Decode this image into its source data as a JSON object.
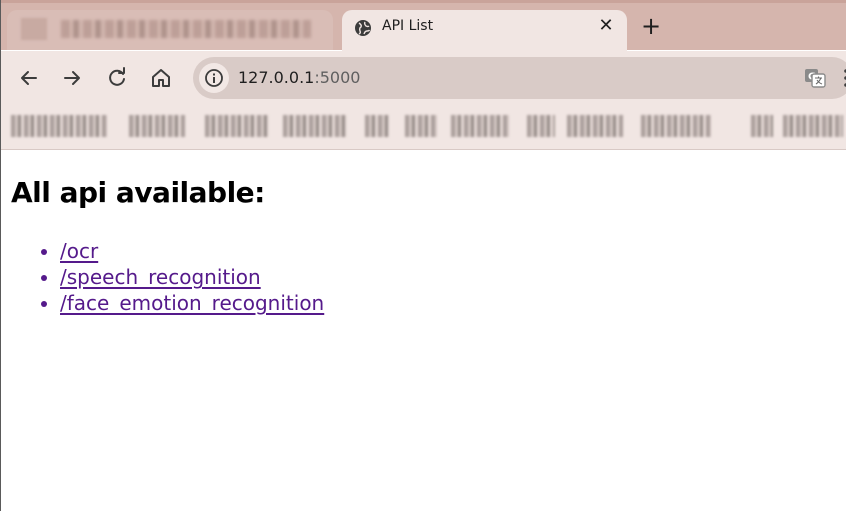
{
  "browser": {
    "tabs": [
      {
        "title": "",
        "active": false
      },
      {
        "title": "API List",
        "active": true
      }
    ],
    "address_bar": {
      "host": "127.0.0.1",
      "port": ":5000"
    },
    "icons": {
      "back": "arrow-left-icon",
      "forward": "arrow-right-icon",
      "reload": "reload-icon",
      "home": "home-icon",
      "site_info": "info-icon",
      "translate": "translate-icon",
      "menu": "more-vertical-icon",
      "new_tab": "plus-icon",
      "close_tab": "close-icon",
      "tab_favicon": "globe-icon"
    },
    "colors": {
      "tabstrip": "#d5b5ad",
      "toolbar": "#f1e6e3",
      "omnibox": "#d9cbc7"
    }
  },
  "page": {
    "heading": "All api available:",
    "apis": [
      {
        "label": "/ocr"
      },
      {
        "label": "/speech_recognition"
      },
      {
        "label": "/face_emotion_recognition"
      }
    ],
    "colors": {
      "link": "#551a8b"
    }
  }
}
